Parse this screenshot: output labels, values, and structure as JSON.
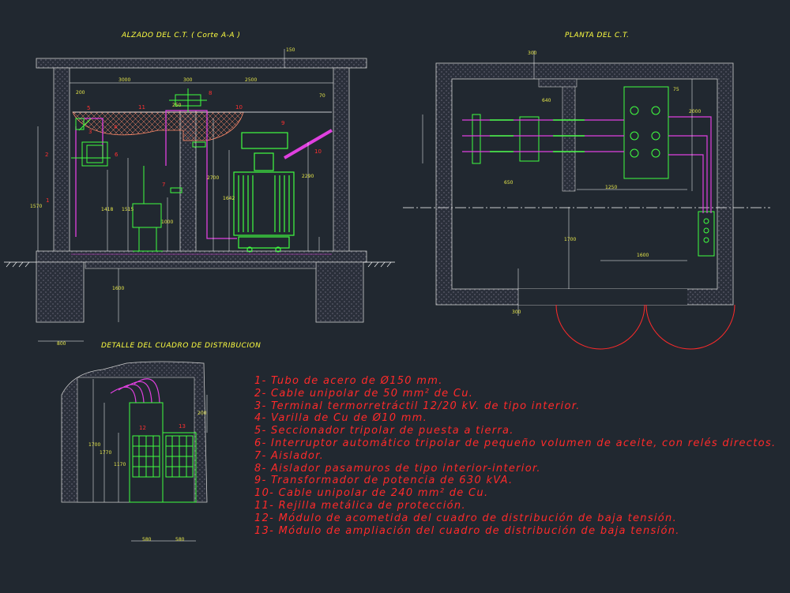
{
  "titles": {
    "elevation": "ALZADO DEL C.T. ( Corte A-A )",
    "plan": "PLANTA DEL C.T.",
    "detail": "DETALLE DEL CUADRO DE DISTRIBUCION"
  },
  "legend": [
    "1- Tubo de acero de Ø150 mm.",
    "2- Cable unipolar de 50 mm² de Cu.",
    "3- Terminal termorretráctil 12/20 kV. de tipo interior.",
    "4- Varilla de Cu de Ø10 mm.",
    "5- Seccionador tripolar de puesta a tierra.",
    "6- Interruptor automático tripolar de pequeño volumen de aceite, con relés directos.",
    "7- Aislador.",
    "8- Aislador pasamuros de tipo interior-interior.",
    "9- Transformador de potencia de 630 kVA.",
    "10- Cable unipolar de 240 mm² de Cu.",
    "11- Rejilla metálica de protección.",
    "12- Módulo de acometida del cuadro de distribución de baja tensión.",
    "13- Módulo de ampliación del cuadro de distribución de baja tensión."
  ],
  "dimensions": {
    "elev_top_150": "150",
    "elev_3000": "3000",
    "elev_300": "300",
    "elev_2500": "2500",
    "elev_200_left": "200",
    "elev_70": "70",
    "elev_250": "250",
    "elev_1570": "1570",
    "elev_1418": "1418",
    "elev_1515": "1515",
    "elev_1000": "1000",
    "elev_2700": "2700",
    "elev_1642": "1642",
    "elev_2290": "2290",
    "elev_800": "800",
    "elev_1600": "1600",
    "plan_300_top": "300",
    "plan_640": "640",
    "plan_2000": "2000",
    "plan_1700": "1700",
    "plan_1600": "1600",
    "plan_300_bottom": "300",
    "plan_1250": "1250",
    "plan_650": "650",
    "plan_75": "75",
    "detail_1700": "1700",
    "detail_1770": "1770",
    "detail_1170": "1170",
    "detail_200": "200",
    "detail_580a": "580",
    "detail_580b": "580"
  },
  "callouts": [
    "1",
    "2",
    "3",
    "4",
    "5",
    "6",
    "7",
    "8",
    "9",
    "10",
    "11",
    "12",
    "13"
  ],
  "colors": {
    "background": "#212830",
    "wall": "#3a3a7a",
    "cable": "#e040e0",
    "equipment": "#40ff40",
    "label": "#ff2a2a",
    "dimension": "#e8e84a",
    "outline": "#ffffff"
  }
}
